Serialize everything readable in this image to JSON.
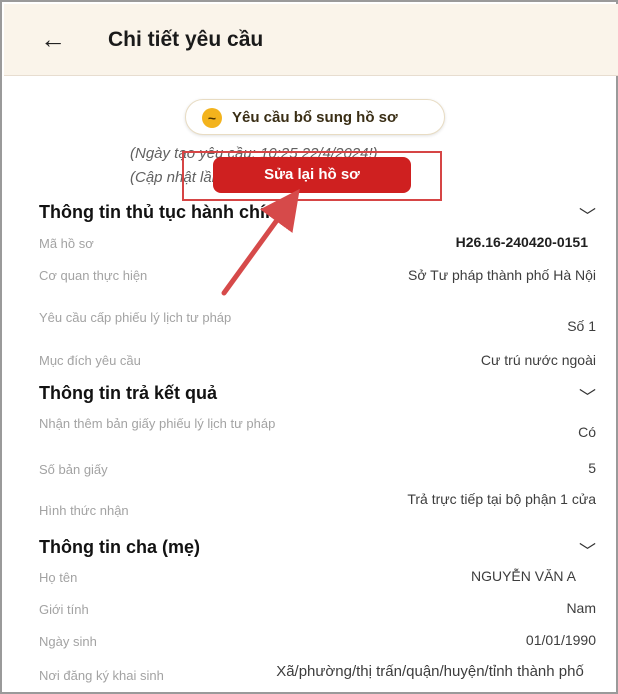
{
  "header": {
    "title": "Chi tiết yêu cầu"
  },
  "status": {
    "label": "Yêu cầu bổ sung hồ sơ"
  },
  "meta": {
    "created": "(Ngày tạo yêu cầu: 10:25 22/4/2024!)",
    "updated": "(Cập nhật lần cuối: 10:36 22/04/2024 !"
  },
  "actions": {
    "edit_label": "Sửa lại hồ sơ"
  },
  "sections": {
    "procedure": {
      "title": "Thông tin thủ tục hành chính",
      "rows": [
        {
          "label": "Mã hồ sơ",
          "value": "H26.16-240420-0151"
        },
        {
          "label": "Cơ quan thực hiện",
          "value": "Sở Tư pháp thành phố Hà Nội"
        },
        {
          "label": "Yêu cầu cấp phiếu lý lịch tư pháp",
          "value": "Số 1"
        },
        {
          "label": "Mục đích yêu cầu",
          "value": "Cư trú nước ngoài"
        }
      ]
    },
    "result": {
      "title": "Thông tin trả kết quả",
      "rows": [
        {
          "label": "Nhận thêm bản giấy phiếu lý lịch tư pháp",
          "value": "Có"
        },
        {
          "label": "Số bản giấy",
          "value": "5"
        },
        {
          "label": "Hình thức nhận",
          "value": "Trả trực tiếp tại bộ phận 1 cửa"
        }
      ]
    },
    "parent": {
      "title": "Thông tin cha (mẹ)",
      "rows": [
        {
          "label": "Họ tên",
          "value": "NGUYỄN VĂN A"
        },
        {
          "label": "Giới tính",
          "value": "Nam"
        },
        {
          "label": "Ngày sinh",
          "value": "01/01/1990"
        },
        {
          "label": "Nơi đăng ký khai sinh",
          "value": "Xã/phường/thị trấn/quận/huyện/tỉnh thành phố"
        }
      ]
    }
  }
}
